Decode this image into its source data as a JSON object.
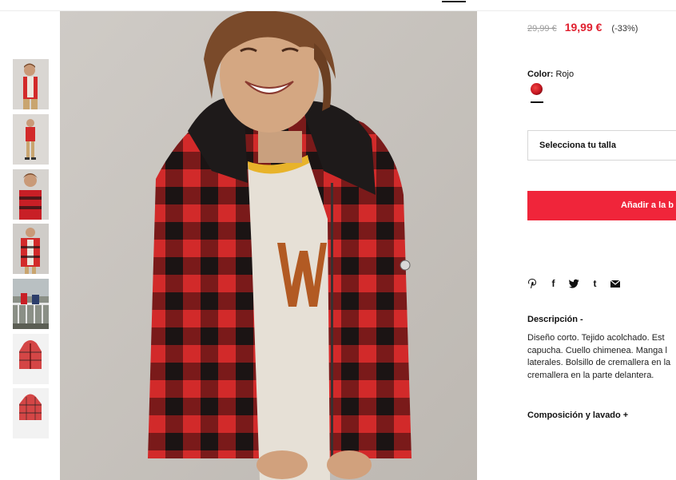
{
  "product": {
    "price_old": "29,99 €",
    "price_new": "19,99 €",
    "discount": "(-33%)",
    "color_label": "Color:",
    "color_value": "Rojo",
    "size_placeholder": "Selecciona tu talla",
    "add_to_cart": "Añadir a la b",
    "description_title": "Descripción -",
    "description_lines": [
      "Diseño corto. Tejido acolchado. Est",
      "capucha. Cuello chimenea. Manga l",
      "laterales. Bolsillo de cremallera en la",
      "cremallera en la parte delantera."
    ],
    "composition_title": "Composición y lavado +"
  },
  "share": {
    "pinterest": "P",
    "facebook": "f",
    "twitter": "twitter",
    "tumblr": "t",
    "email": "email"
  },
  "colors": {
    "accent": "#f0253a",
    "price": "#e0202f",
    "plaid_red": "#d22a2a",
    "plaid_black": "#1b1414"
  },
  "thumbnails": [
    "thumb-front",
    "thumb-full-body",
    "thumb-side",
    "thumb-detail",
    "thumb-outdoor",
    "thumb-flat-front",
    "thumb-flat-back"
  ]
}
